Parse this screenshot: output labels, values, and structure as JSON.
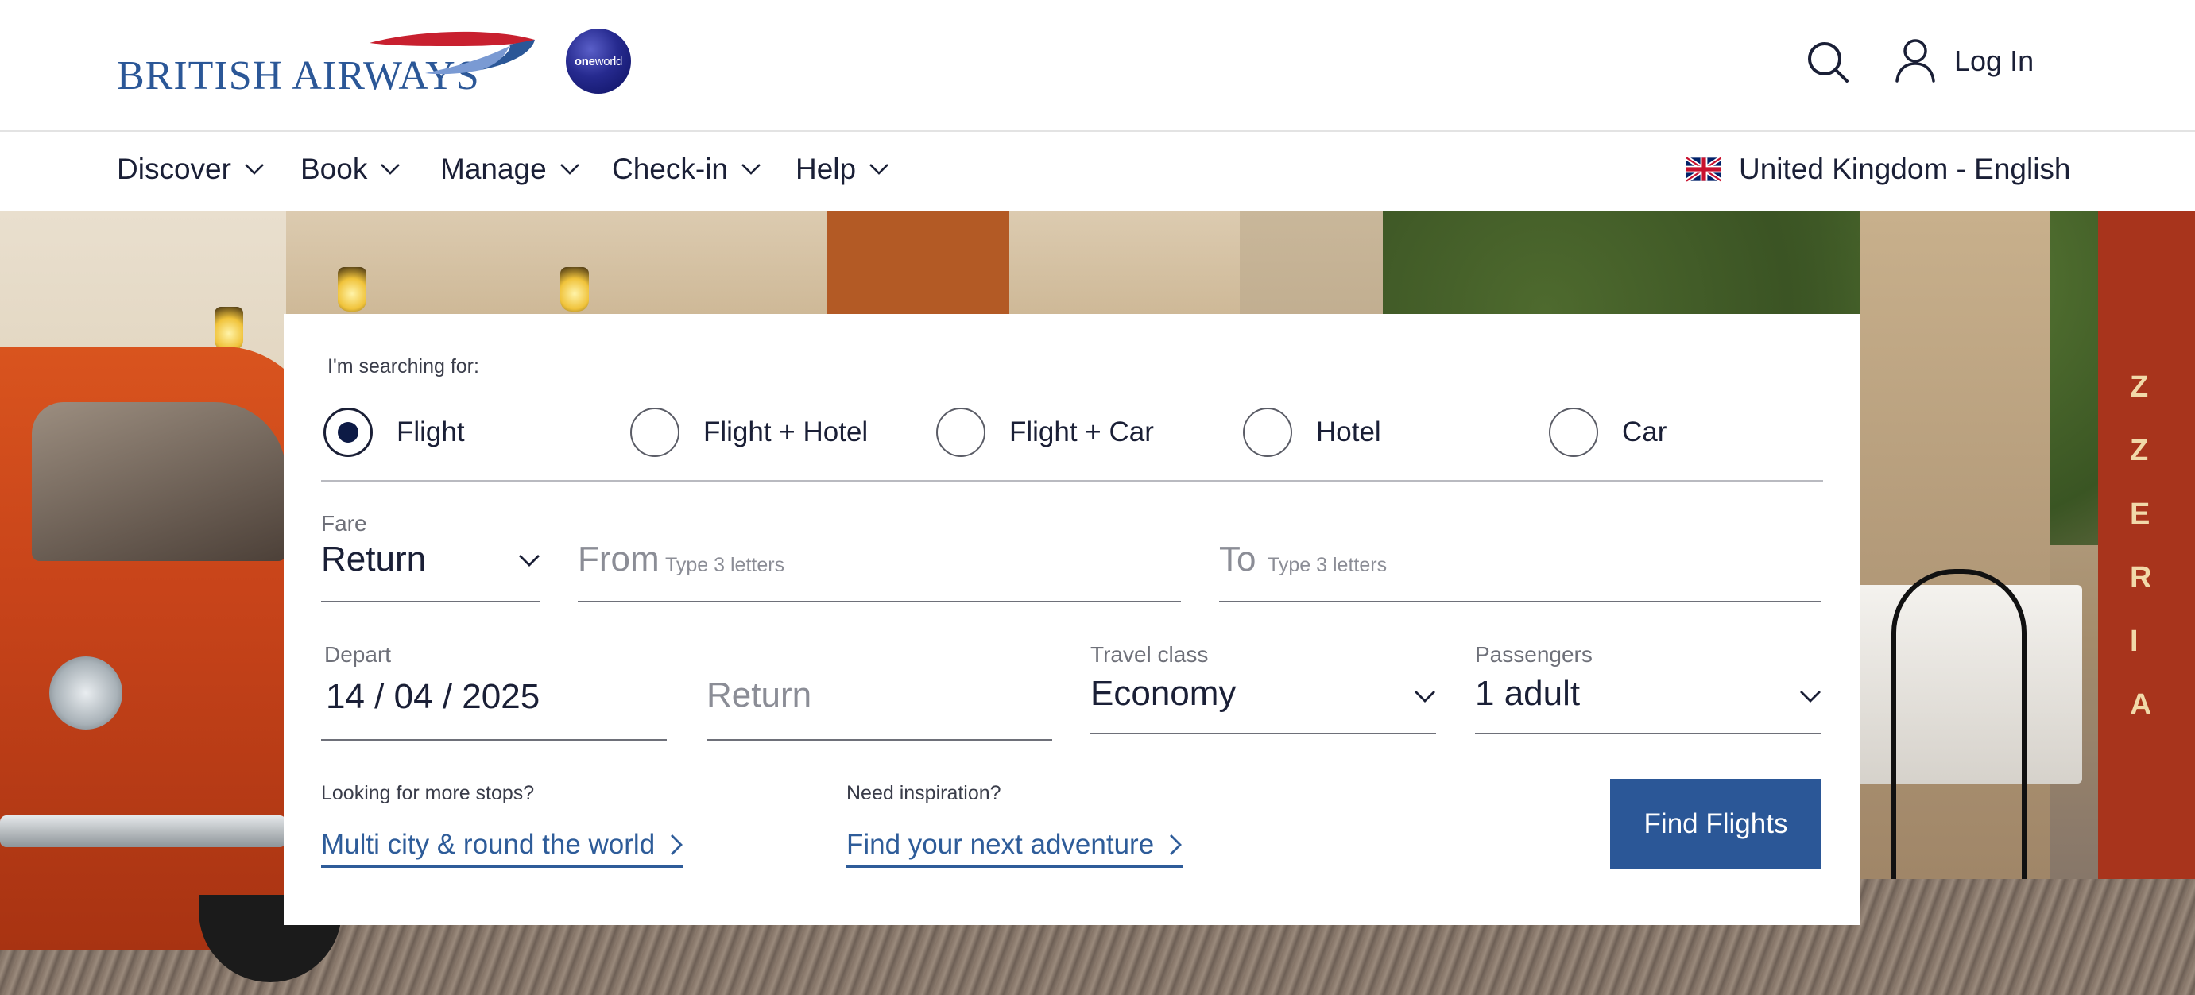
{
  "header": {
    "brand_name": "BRITISH AIRWAYS",
    "alliance_badge": "oneworld",
    "search_icon": "search-icon",
    "user_icon": "user-icon",
    "login_label": "Log In"
  },
  "nav": {
    "items": [
      {
        "label": "Discover"
      },
      {
        "label": "Book"
      },
      {
        "label": "Manage"
      },
      {
        "label": "Check-in"
      },
      {
        "label": "Help"
      }
    ],
    "locale": {
      "flag_icon": "uk-flag-icon",
      "label": "United Kingdom - English"
    }
  },
  "search": {
    "searching_for_label": "I'm searching for:",
    "types": [
      {
        "label": "Flight",
        "selected": true
      },
      {
        "label": "Flight + Hotel",
        "selected": false
      },
      {
        "label": "Flight + Car",
        "selected": false
      },
      {
        "label": "Hotel",
        "selected": false
      },
      {
        "label": "Car",
        "selected": false
      }
    ],
    "fare": {
      "label": "Fare",
      "value": "Return"
    },
    "from": {
      "label": "From",
      "placeholder": "Type 3 letters"
    },
    "to": {
      "label": "To",
      "placeholder": "Type 3 letters"
    },
    "depart": {
      "label": "Depart",
      "day": "14",
      "month": "04",
      "year": "2025"
    },
    "return": {
      "placeholder": "Return"
    },
    "travel_class": {
      "label": "Travel class",
      "value": "Economy"
    },
    "passengers": {
      "label": "Passengers",
      "value": "1 adult"
    },
    "more_stops": {
      "prompt": "Looking for more stops?",
      "link": "Multi city & round the world"
    },
    "inspiration": {
      "prompt": "Need inspiration?",
      "link": "Find your next adventure"
    },
    "submit_label": "Find Flights"
  },
  "colors": {
    "brand_blue": "#2b5797",
    "navy_text": "#1a1f36",
    "link_blue": "#2e5c99",
    "radio_selected": "#0d1a45"
  }
}
